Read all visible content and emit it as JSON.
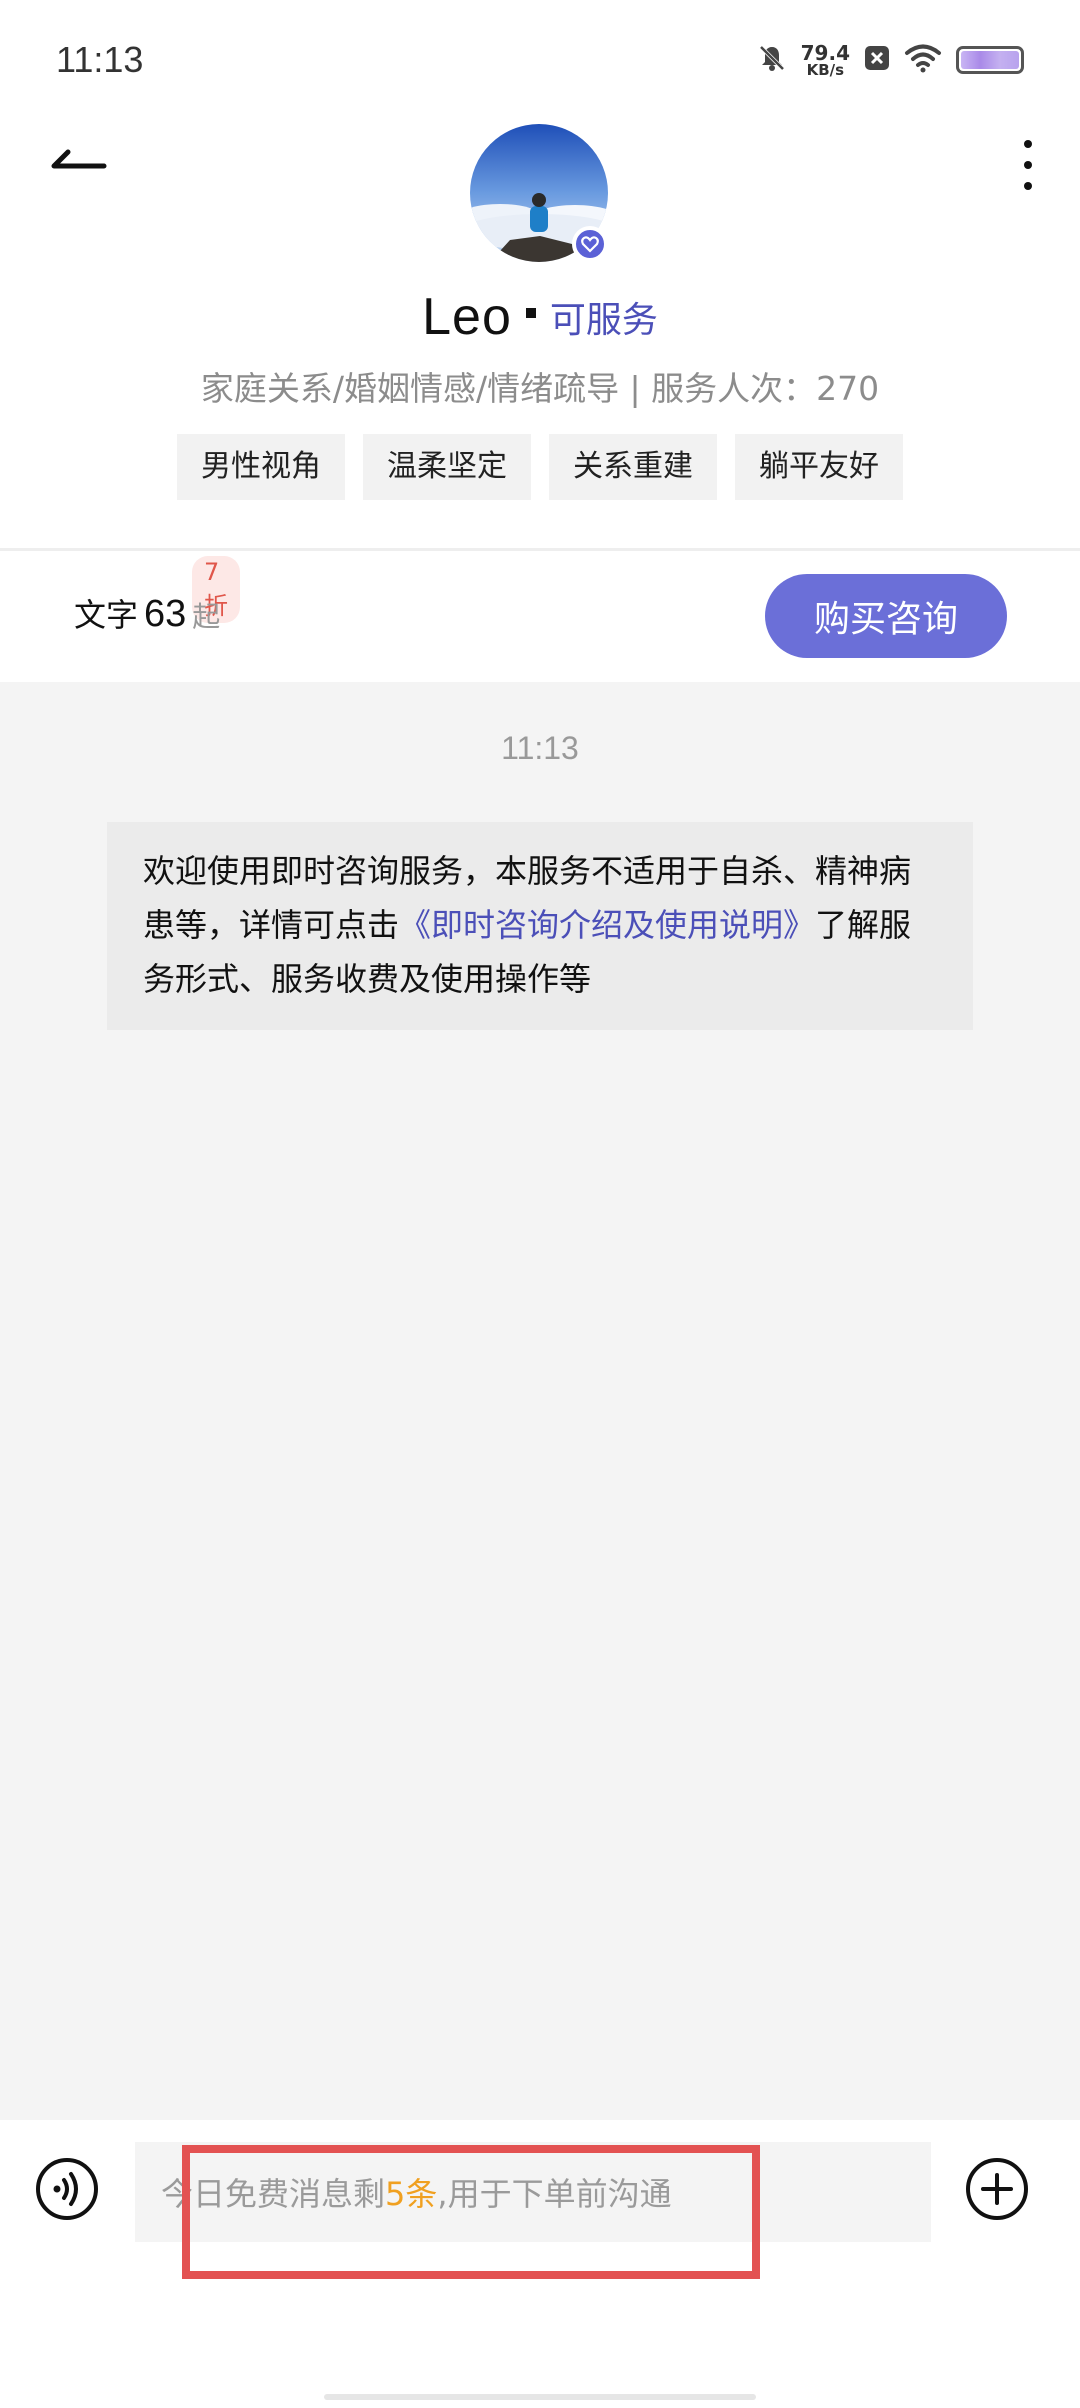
{
  "status_bar": {
    "time": "11:13",
    "net_speed_value": "79.4",
    "net_speed_unit": "KB/s",
    "icons": [
      "mute-bell-icon",
      "close-box-icon",
      "wifi-icon",
      "battery-icon"
    ]
  },
  "profile": {
    "name": "Leo",
    "status": "可服务",
    "description": "家庭关系/婚姻情感/情绪疏导 | 服务人次：270",
    "tags": [
      "男性视角",
      "温柔坚定",
      "关系重建",
      "躺平友好"
    ]
  },
  "pricing": {
    "label": "文字",
    "price": "63",
    "suffix": "起",
    "discount": "7折",
    "buy_button": "购买咨询"
  },
  "chat": {
    "timestamp": "11:13",
    "system_message": {
      "text_before": "欢迎使用即时咨询服务，本服务不适用于自杀、精神病患等，详情可点击",
      "link": "《即时咨询介绍及使用说明》",
      "text_after": "了解服务形式、服务收费及使用操作等"
    }
  },
  "input": {
    "prefix": "今日免费消息剩",
    "count": "5条",
    "suffix": ",用于下单前沟通"
  },
  "colors": {
    "accent": "#6b6fd8",
    "link": "#4b4fb8",
    "highlight": "#f0a020",
    "annotation": "#e35252"
  }
}
